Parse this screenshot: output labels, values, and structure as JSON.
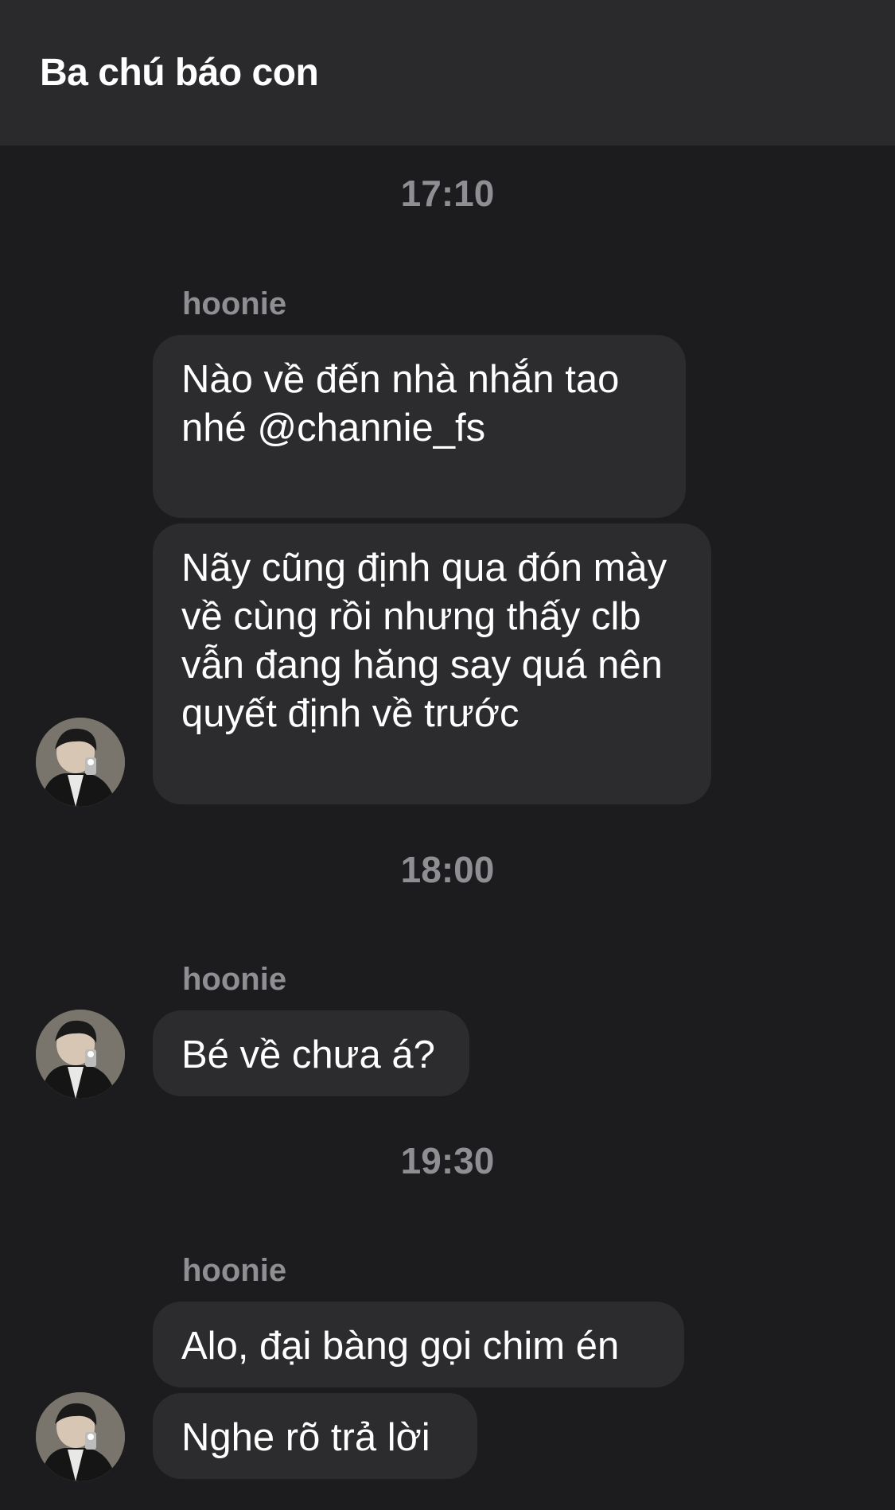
{
  "header": {
    "title": "Ba chú báo con"
  },
  "messages_groups": [
    {
      "time": "17:10",
      "sender": "hoonie",
      "bubbles": [
        "Nào về đến nhà nhắn tao nhé @channie_fs",
        "Nãy cũng định qua đón mày về cùng rồi nhưng thấy clb vẫn đang hăng say quá nên quyết định về trước"
      ]
    },
    {
      "time": "18:00",
      "sender": "hoonie",
      "bubbles": [
        "Bé về chưa á?"
      ]
    },
    {
      "time": "19:30",
      "sender": "hoonie",
      "bubbles": [
        "Alo, đại bàng gọi chim én",
        "Nghe rõ trả lời"
      ]
    }
  ],
  "colors": {
    "background": "#1c1c1e",
    "header": "#2a2a2c",
    "bubble": "#2c2c2e",
    "muted_text": "#8e8e93"
  },
  "icons": {
    "avatar": "profile-photo-avatar"
  }
}
